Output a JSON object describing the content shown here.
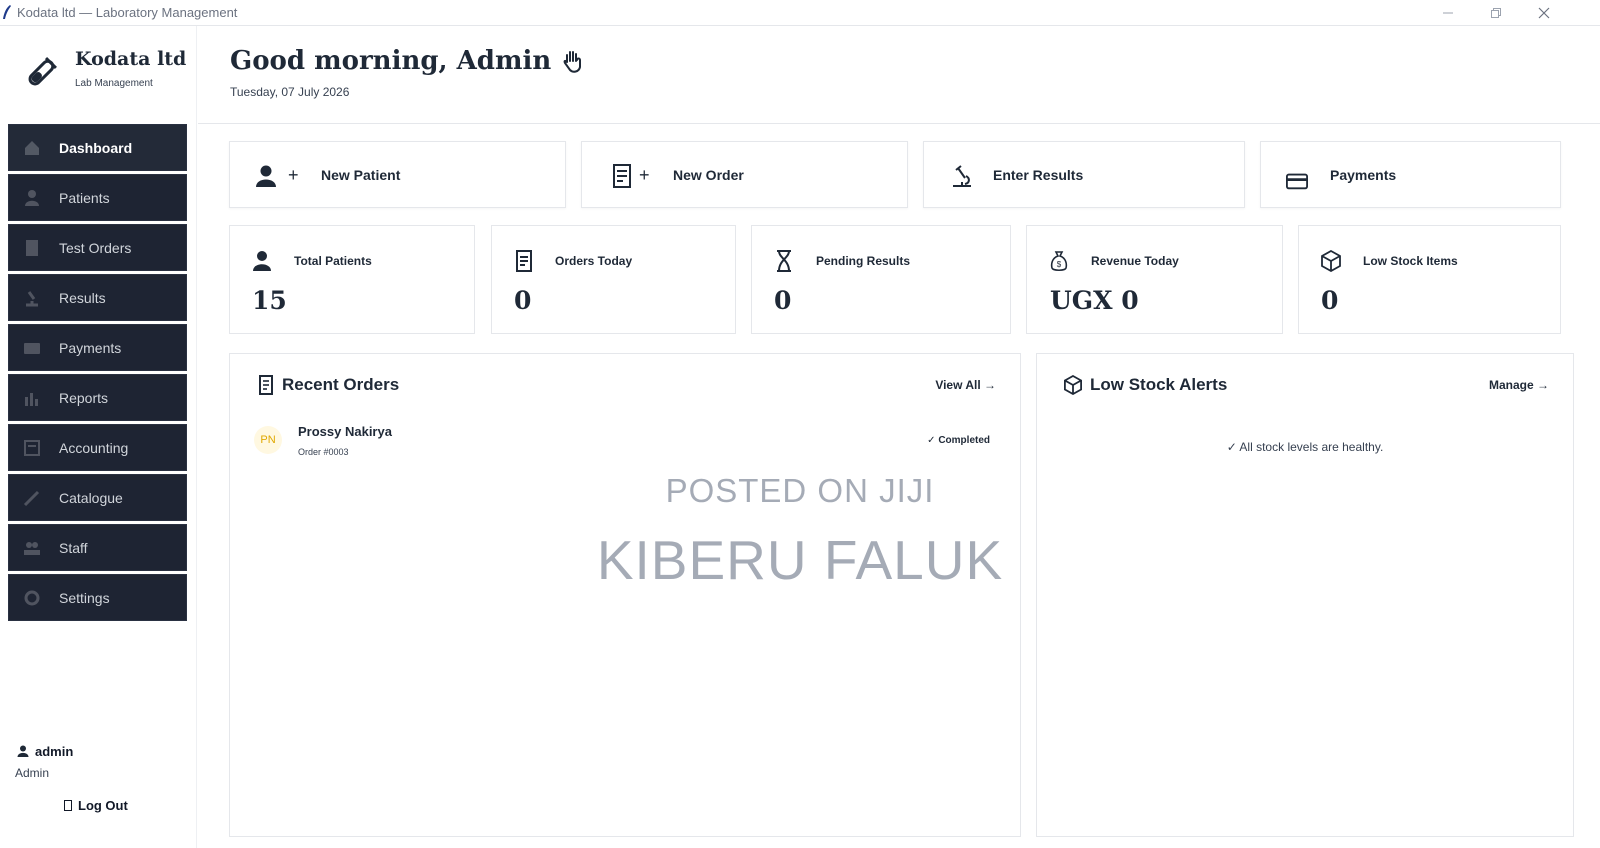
{
  "window": {
    "title": "Kodata ltd — Laboratory Management",
    "controls": [
      "minimize",
      "restore",
      "close"
    ]
  },
  "sidebar": {
    "brand_name": "Kodata ltd",
    "brand_sub": "Lab Management",
    "items": [
      {
        "label": "Dashboard",
        "icon": "home-icon",
        "active": true
      },
      {
        "label": "Patients",
        "icon": "user-icon"
      },
      {
        "label": "Test Orders",
        "icon": "clipboard-icon"
      },
      {
        "label": "Results",
        "icon": "microscope-icon"
      },
      {
        "label": "Payments",
        "icon": "card-icon"
      },
      {
        "label": "Reports",
        "icon": "chart-icon"
      },
      {
        "label": "Accounting",
        "icon": "ledger-icon"
      },
      {
        "label": "Catalogue",
        "icon": "pipette-icon"
      },
      {
        "label": "Staff",
        "icon": "staff-icon"
      },
      {
        "label": "Settings",
        "icon": "gear-icon"
      }
    ],
    "user": {
      "name": "admin",
      "role": "Admin"
    },
    "logout_label": "Log Out"
  },
  "header": {
    "greeting": "Good morning, Admin",
    "date": "Tuesday, 07 July 2026"
  },
  "actions": [
    {
      "label": "New Patient",
      "icon": "user-plus-icon"
    },
    {
      "label": "New Order",
      "icon": "receipt-plus-icon"
    },
    {
      "label": "Enter Results",
      "icon": "microscope-icon"
    },
    {
      "label": "Payments",
      "icon": "card-icon"
    }
  ],
  "stats": [
    {
      "label": "Total Patients",
      "value": "15",
      "icon": "user-icon"
    },
    {
      "label": "Orders Today",
      "value": "0",
      "icon": "receipt-icon"
    },
    {
      "label": "Pending Results",
      "value": "0",
      "icon": "hourglass-icon"
    },
    {
      "label": "Revenue Today",
      "value": "UGX 0",
      "icon": "money-bag-icon"
    },
    {
      "label": "Low Stock Items",
      "value": "0",
      "icon": "box-icon"
    }
  ],
  "recent_orders": {
    "title": "Recent Orders",
    "link": "View All →",
    "orders": [
      {
        "initials": "PN",
        "name": "Prossy Nakirya",
        "order_id": "Order #0003",
        "status": "✓ Completed"
      }
    ]
  },
  "low_stock": {
    "title": "Low Stock Alerts",
    "link": "Manage →",
    "message": "✓ All stock levels are healthy."
  },
  "watermark": {
    "line1": "POSTED ON JIJI",
    "line2": "KIBERU FALUK"
  },
  "colors": {
    "sidebar_item_bg": "#1e2433",
    "avatar_text": "#e0a800",
    "text_dark": "#1f2937"
  }
}
